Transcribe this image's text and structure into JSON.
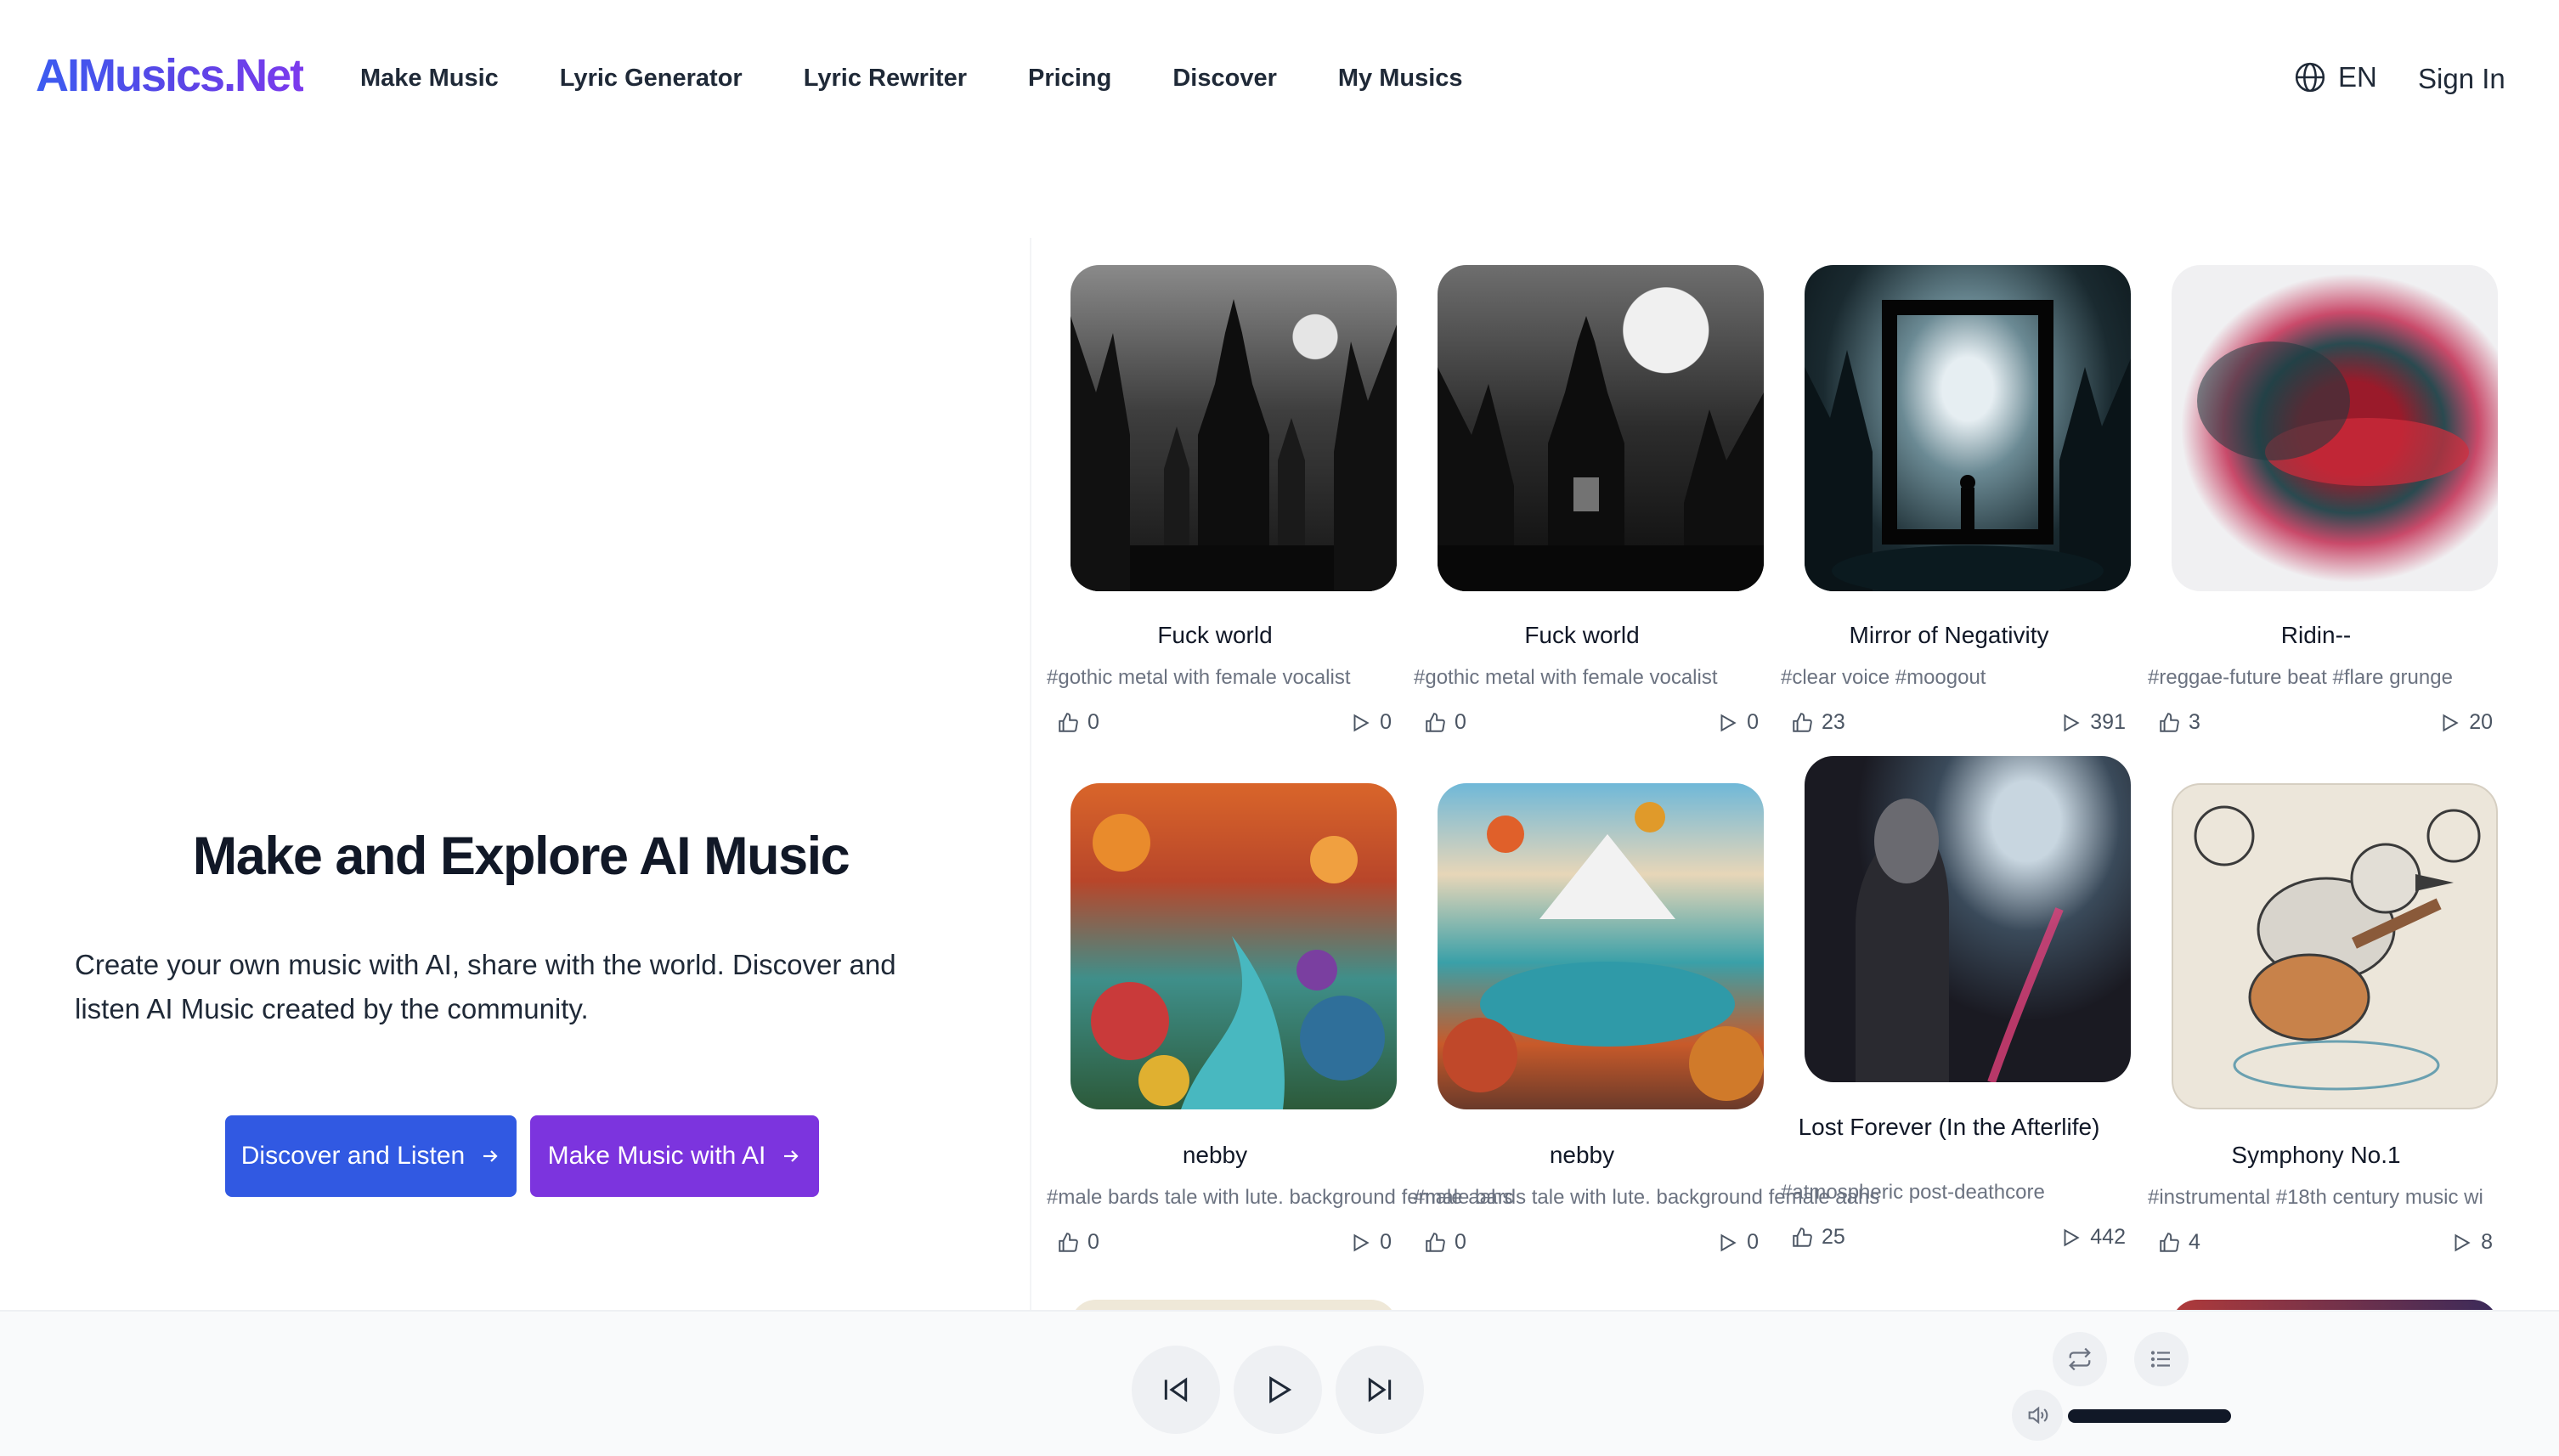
{
  "header": {
    "logo": "AIMusics.Net",
    "nav": [
      "Make Music",
      "Lyric Generator",
      "Lyric Rewriter",
      "Pricing",
      "Discover",
      "My Musics"
    ],
    "lang": "EN",
    "signin": "Sign In"
  },
  "hero": {
    "title": "Make and Explore AI Music",
    "desc": "Create your own music with AI, share with the world. Discover and listen AI Music created by the community.",
    "btn_discover": "Discover and Listen",
    "btn_make": "Make Music with AI"
  },
  "songs": [
    {
      "title": "Fuck world",
      "tags": "#gothic metal with female vocalist",
      "likes": "0",
      "plays": "0"
    },
    {
      "title": "Fuck world",
      "tags": "#gothic metal with female vocalist",
      "likes": "0",
      "plays": "0"
    },
    {
      "title": "Mirror of Negativity",
      "tags": "#clear voice #moogout",
      "likes": "23",
      "plays": "391"
    },
    {
      "title": "Ridin--",
      "tags": "#reggae-future beat #flare grunge",
      "likes": "3",
      "plays": "20"
    },
    {
      "title": "nebby",
      "tags": "#male bards tale with lute. background female aahs",
      "likes": "0",
      "plays": "0"
    },
    {
      "title": "nebby",
      "tags": "#male bards tale with lute. background female aahs",
      "likes": "0",
      "plays": "0"
    },
    {
      "title": "Lost Forever (In the Afterlife)",
      "tags": "#atmospheric post-deathcore",
      "likes": "25",
      "plays": "442"
    },
    {
      "title": "Symphony No.1",
      "tags": "#instrumental #18th century music wi",
      "likes": "4",
      "plays": "8"
    }
  ],
  "colors": {
    "blue": "#3159e2",
    "purple": "#7c34de",
    "text": "#111827",
    "muted": "#6b7280"
  }
}
